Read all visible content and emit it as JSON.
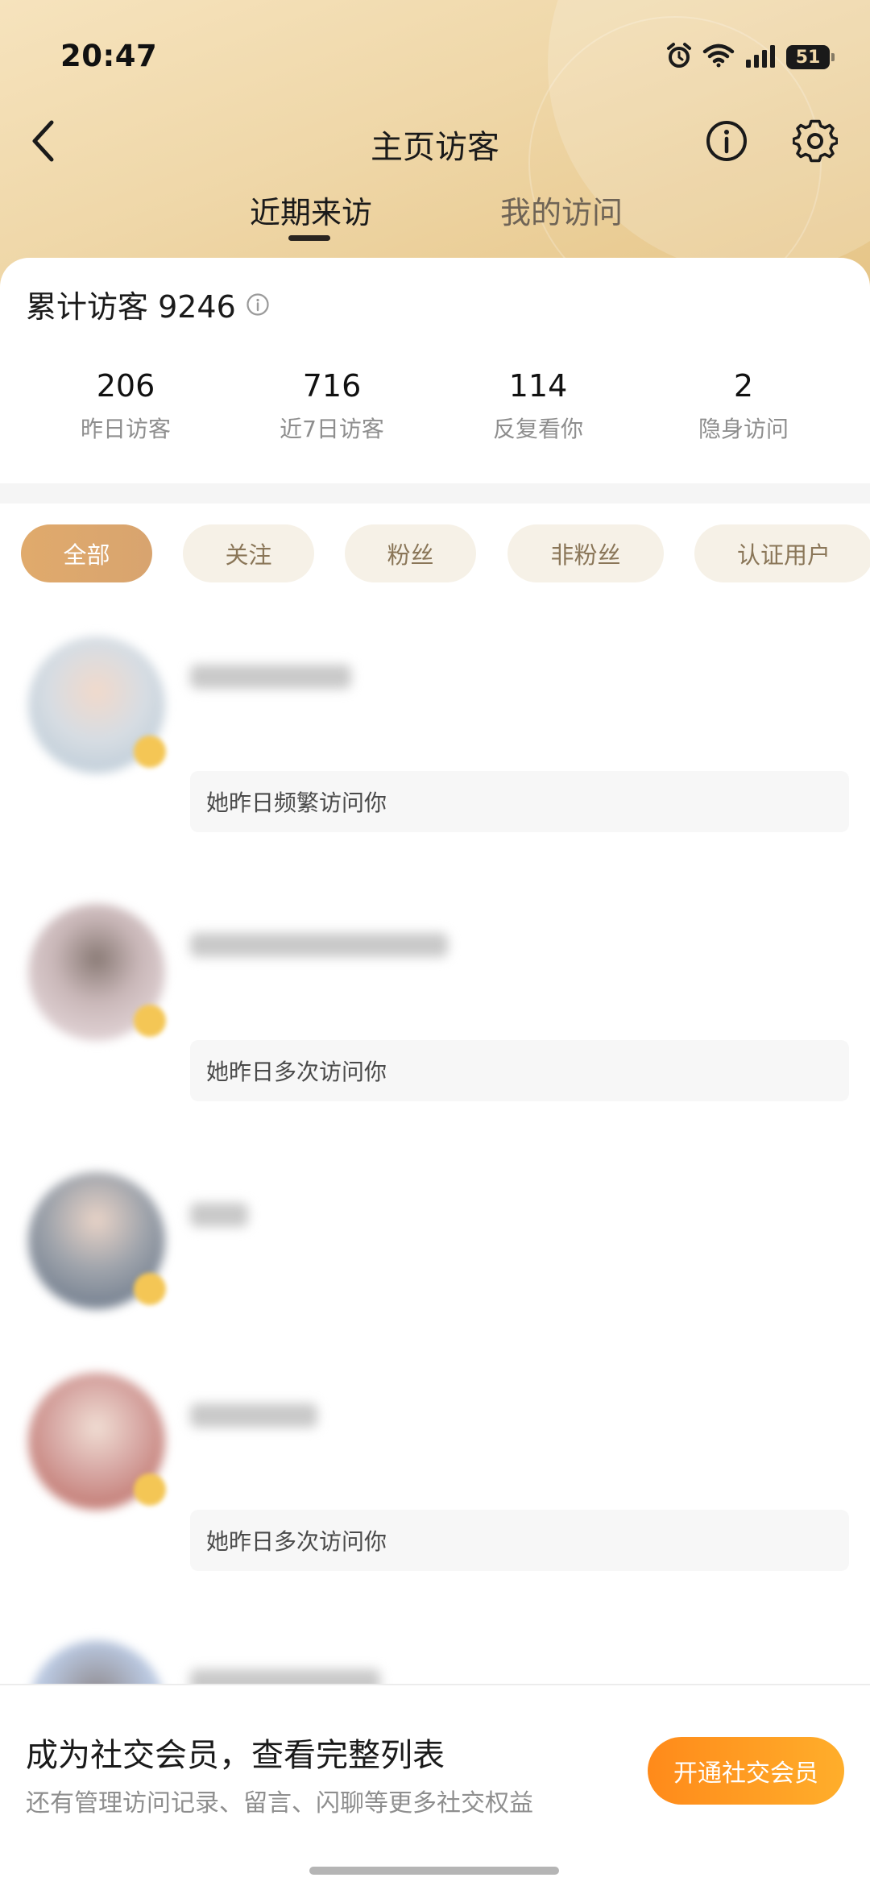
{
  "status_bar": {
    "time": "20:47",
    "battery": "51",
    "icons": [
      "alarm-icon",
      "wifi-icon",
      "cellular-signal-icon",
      "battery-icon"
    ]
  },
  "nav": {
    "title": "主页访客",
    "back_icon": "chevron-left-icon",
    "info_icon": "info-circle-icon",
    "settings_icon": "gear-icon"
  },
  "tabs": [
    {
      "label": "近期来访",
      "active": true
    },
    {
      "label": "我的访问",
      "active": false
    }
  ],
  "summary": {
    "total_label": "累计访客 9246"
  },
  "stats": [
    {
      "value": "206",
      "label": "昨日访客"
    },
    {
      "value": "716",
      "label": "近7日访客"
    },
    {
      "value": "114",
      "label": "反复看你"
    },
    {
      "value": "2",
      "label": "隐身访问"
    }
  ],
  "filters": [
    {
      "label": "全部",
      "active": true
    },
    {
      "label": "关注",
      "active": false
    },
    {
      "label": "粉丝",
      "active": false
    },
    {
      "label": "非粉丝",
      "active": false
    },
    {
      "label": "认证用户",
      "active": false
    }
  ],
  "visitors": [
    {
      "note": "她昨日频繁访问你"
    },
    {
      "note": "她昨日多次访问你"
    },
    {
      "note": ""
    },
    {
      "note": "她昨日多次访问你"
    },
    {
      "note": ""
    }
  ],
  "promo": {
    "title": "成为社交会员，查看完整列表",
    "subtitle": "还有管理访问记录、留言、闪聊等更多社交权益",
    "button_label": "开通社交会员"
  },
  "colors": {
    "header_gradient_start": "#f6e3bd",
    "header_gradient_end": "#e6c587",
    "chip_active": "#dca56d",
    "chip_inactive_bg": "#f6f1e7",
    "promo_button": "#ff9a1f"
  }
}
